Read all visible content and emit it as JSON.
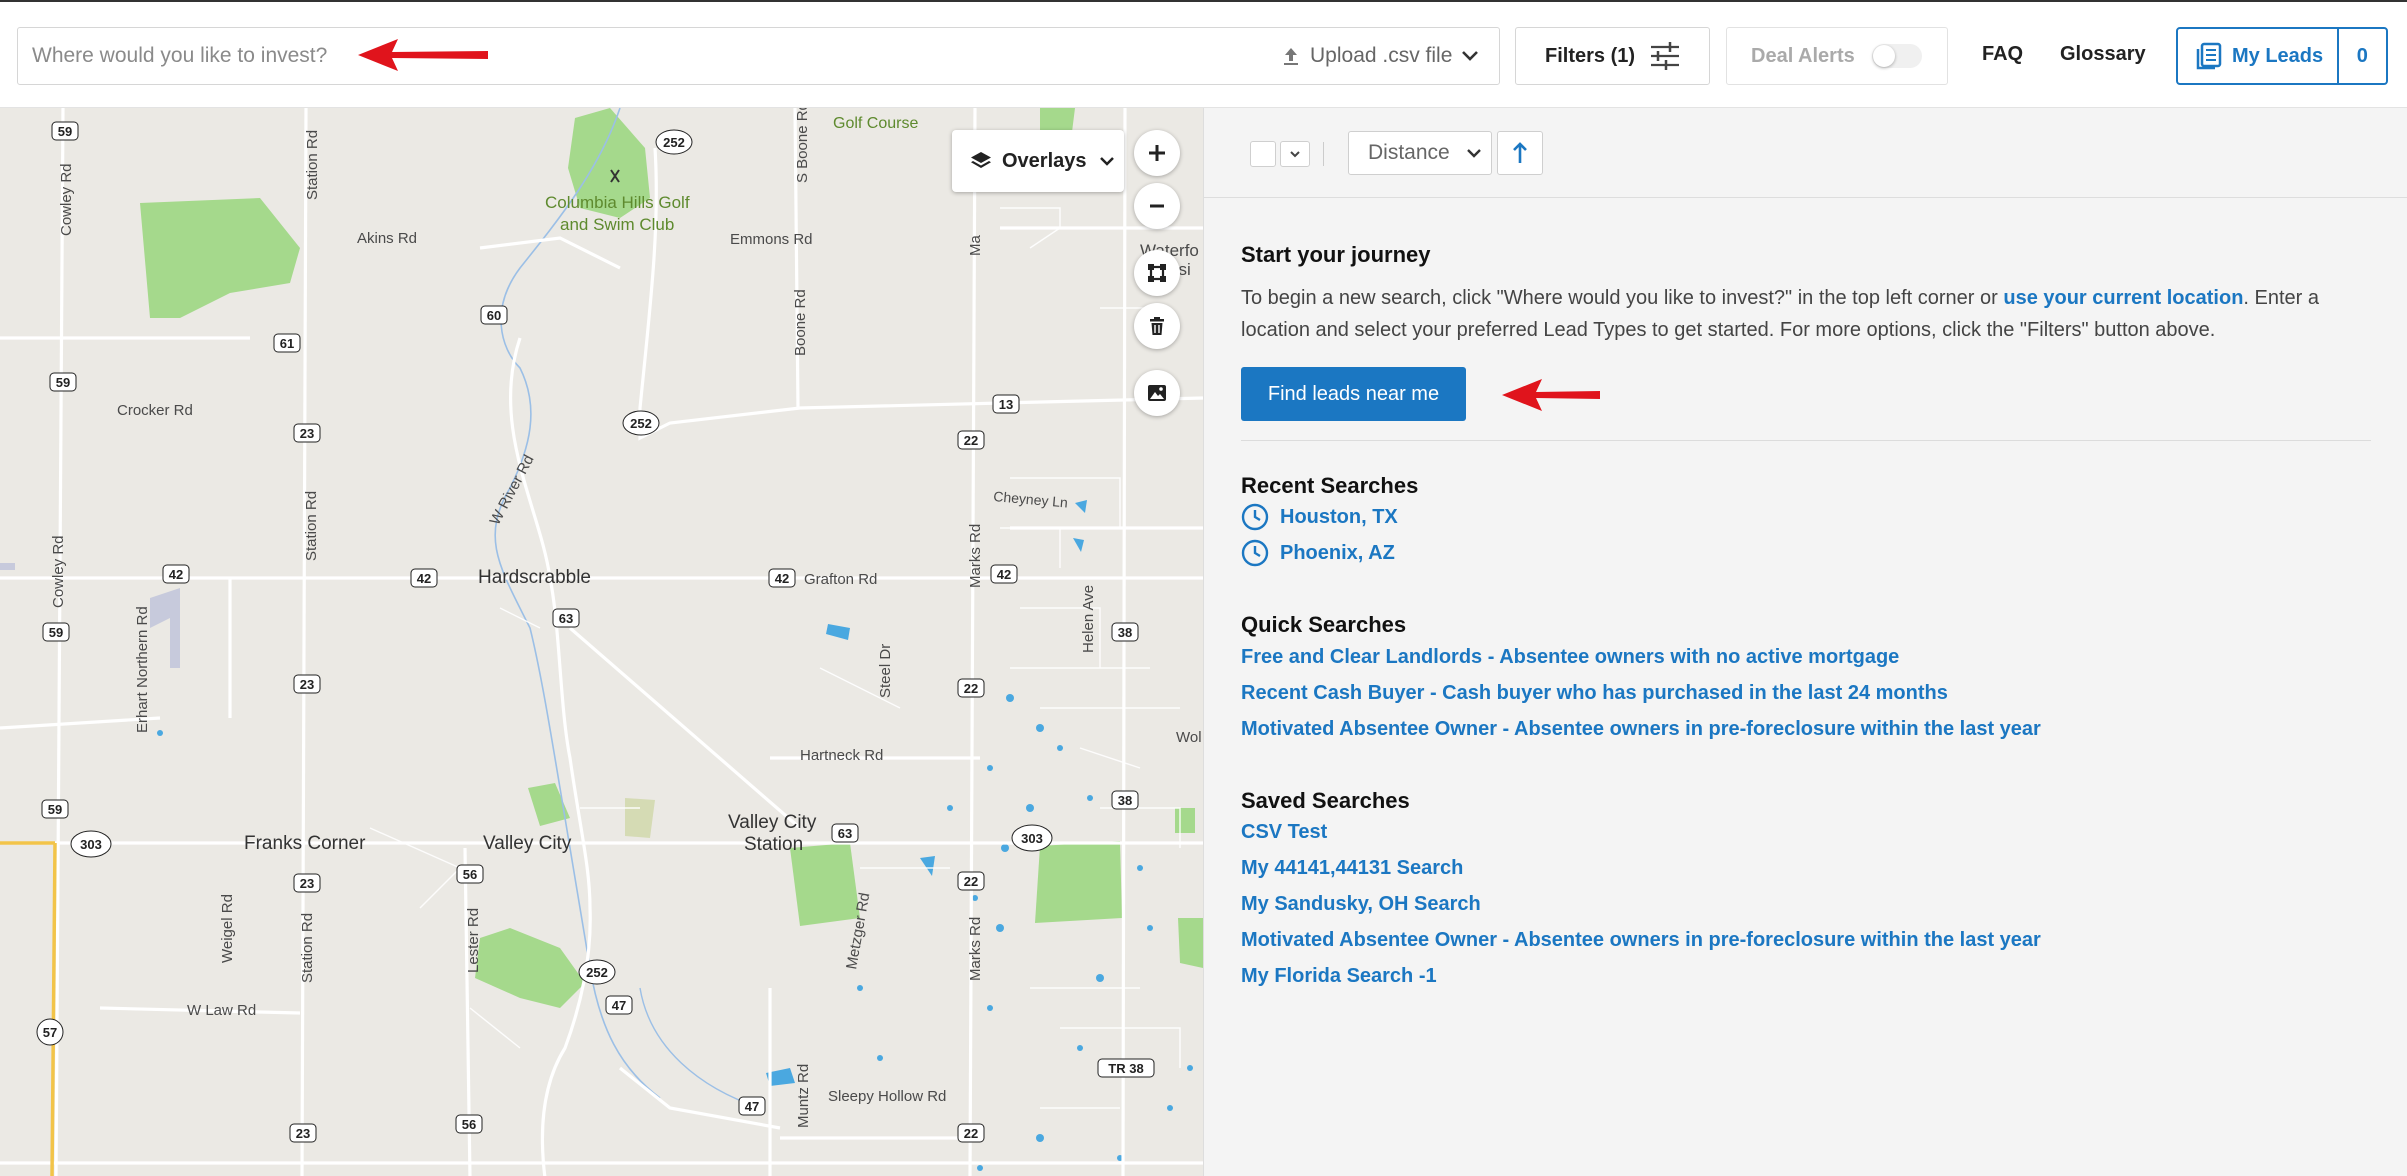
{
  "header": {
    "search_placeholder": "Where would you like to invest?",
    "upload_label": "Upload .csv file",
    "filters_label": "Filters (1)",
    "deal_alerts_label": "Deal Alerts",
    "deal_alerts_enabled": false,
    "faq_label": "FAQ",
    "glossary_label": "Glossary",
    "my_leads_label": "My Leads",
    "my_leads_count": "0"
  },
  "map": {
    "overlays_label": "Overlays",
    "labels": {
      "golf_course": "Golf Course",
      "columbia_hills_1": "Columbia Hills Golf",
      "columbia_hills_2": "and Swim Club",
      "akins": "Akins Rd",
      "emmons": "Emmons Rd",
      "crocker": "Crocker Rd",
      "station_1": "Station Rd",
      "station_2": "Station Rd",
      "station_3": "Station Rd",
      "cowley_1": "Cowley Rd",
      "cowley_2": "Cowley Rd",
      "sboone": "S Boone Rd",
      "boone": "Boone Rd",
      "wriver": "W River Rd",
      "hardscrabble": "Hardscrabble",
      "grafton": "Grafton Rd",
      "cheyney": "Cheyney Ln",
      "marks_1": "Marks Rd",
      "marks_2": "Marks Rd",
      "marks_3": "Ma",
      "helen": "Helen Ave",
      "steel": "Steel Dr",
      "erhart": "Erhart Northern Rd",
      "hartneck": "Hartneck Rd",
      "franks": "Franks Corner",
      "valley_city": "Valley City",
      "vcs_1": "Valley City",
      "vcs_2": "Station",
      "weigel": "Weigel Rd",
      "lester": "Lester Rd",
      "metzger": "Metzger Rd",
      "wlaw": "W Law Rd",
      "sleepy": "Sleepy Hollow Rd",
      "muntz": "Muntz Rd",
      "waterf": "Waterfo",
      "waterf2": "ssi",
      "wol": "Wol"
    },
    "shields": {
      "s59a": "59",
      "s252a": "252",
      "s60": "60",
      "s61": "61",
      "s59b": "59",
      "s252b": "252",
      "s13": "13",
      "s23a": "23",
      "s22a": "22",
      "s42a": "42",
      "s42b": "42",
      "s63": "63",
      "s42c": "42",
      "s42d": "42",
      "s59c": "59",
      "s38a": "38",
      "s23b": "23",
      "s22b": "22",
      "s59d": "59",
      "s303a": "303",
      "s63b": "63",
      "s303b": "303",
      "s38b": "38",
      "s23c": "23",
      "s56a": "56",
      "s22c": "22",
      "s252c": "252",
      "s47a": "47",
      "s57": "57",
      "tr38": "TR 38",
      "s47b": "47",
      "s23d": "23",
      "s56b": "56",
      "s22d": "22"
    }
  },
  "panel": {
    "sort_label": "Distance",
    "journey_title": "Start your journey",
    "journey_text_1": "To begin a new search, click \"Where would you like to invest?\" in the top left corner or ",
    "journey_link": "use your current location",
    "journey_text_2": ". Enter a location and select your preferred Lead Types to get started. For more options, click the \"Filters\" button above.",
    "find_leads_label": "Find leads near me",
    "recent_title": "Recent Searches",
    "recent": [
      "Houston, TX",
      "Phoenix, AZ"
    ],
    "quick_title": "Quick Searches",
    "quick": [
      "Free and Clear Landlords - Absentee owners with no active mortgage",
      "Recent Cash Buyer - Cash buyer who has purchased in the last 24 months",
      "Motivated Absentee Owner - Absentee owners in pre-foreclosure within the last year"
    ],
    "saved_title": "Saved Searches",
    "saved": [
      "CSV Test",
      "My 44141,44131 Search",
      "My Sandusky, OH Search",
      "Motivated Absentee Owner - Absentee owners in pre-foreclosure within the last year",
      "My Florida Search -1"
    ]
  },
  "colors": {
    "accent": "#1b77c2",
    "arrow": "#e0141c",
    "map_bg": "#ebe9e4",
    "park": "#a5d98c",
    "water": "#4aa8e0"
  }
}
